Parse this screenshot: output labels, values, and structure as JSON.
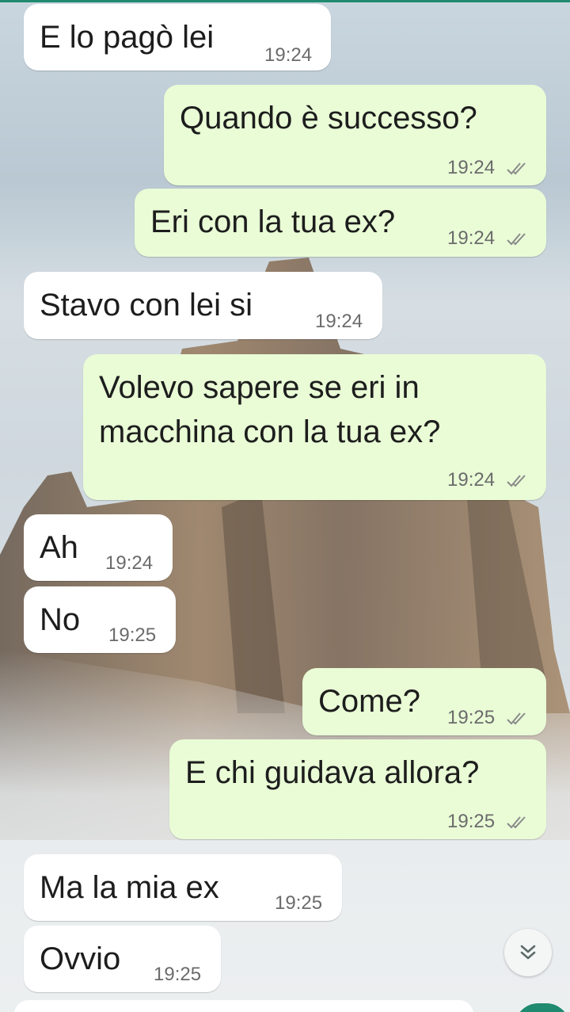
{
  "chat": {
    "messages": [
      {
        "id": "m1",
        "direction": "incoming",
        "text": "E lo pagò lei",
        "time": "19:24"
      },
      {
        "id": "m2",
        "direction": "outgoing",
        "text": "Quando è successo?",
        "time": "19:24",
        "status": "read"
      },
      {
        "id": "m3",
        "direction": "outgoing",
        "text": "Eri con la tua ex?",
        "time": "19:24",
        "status": "read"
      },
      {
        "id": "m4",
        "direction": "incoming",
        "text": "Stavo con lei si",
        "time": "19:24"
      },
      {
        "id": "m5",
        "direction": "outgoing",
        "lines": [
          "Volevo sapere se eri in",
          "macchina con la tua ex?"
        ],
        "time": "19:24",
        "status": "read"
      },
      {
        "id": "m6",
        "direction": "incoming",
        "text": "Ah",
        "time": "19:24"
      },
      {
        "id": "m7",
        "direction": "incoming",
        "text": "No",
        "time": "19:25"
      },
      {
        "id": "m8",
        "direction": "outgoing",
        "text": "Come?",
        "time": "19:25",
        "status": "read"
      },
      {
        "id": "m9",
        "direction": "outgoing",
        "text": "E chi guidava allora?",
        "time": "19:25",
        "status": "read"
      },
      {
        "id": "m10",
        "direction": "incoming",
        "text": "Ma la mia ex",
        "time": "19:25"
      },
      {
        "id": "m11",
        "direction": "incoming",
        "text": "Ovvio",
        "time": "19:25"
      }
    ]
  },
  "icons": {
    "read_receipt": "double-check-icon",
    "scroll_down": "chevron-double-down-icon"
  },
  "colors": {
    "incoming_bubble": "#ffffff",
    "outgoing_bubble": "#e9fcd6",
    "accent": "#1f8a70",
    "timestamp": "#6b6b6b"
  }
}
